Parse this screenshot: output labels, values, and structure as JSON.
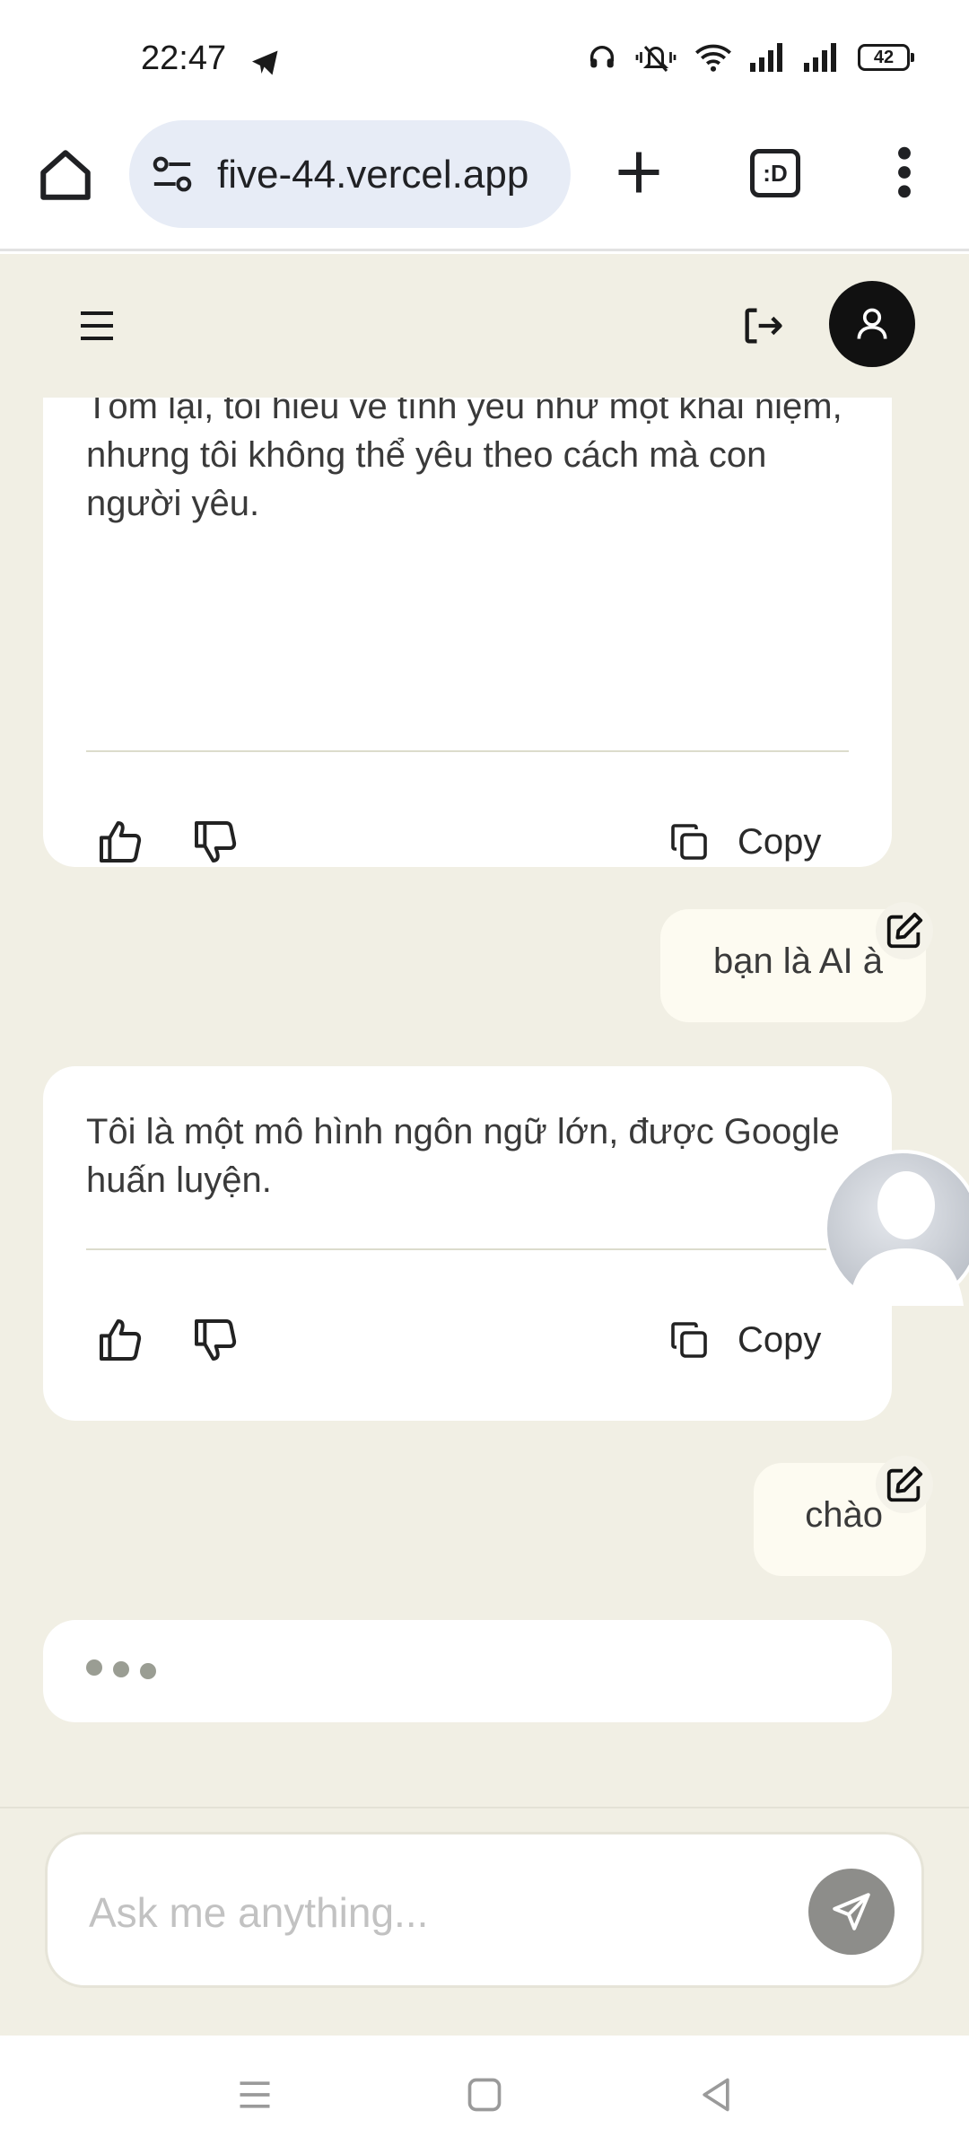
{
  "status_bar": {
    "time": "22:47",
    "battery": "42",
    "icons": [
      "telegram-icon",
      "headset-icon",
      "silent-vibrate-icon",
      "wifi-icon",
      "signal-icon",
      "signal-icon",
      "battery-icon"
    ]
  },
  "browser": {
    "url": "five-44.vercel.app",
    "tabs_label": ":D",
    "icons": [
      "home-icon",
      "site-settings-icon",
      "plus-icon",
      "tab-switcher-icon",
      "more-vert-icon"
    ]
  },
  "app_header": {
    "icons": [
      "hamburger-icon",
      "logout-icon",
      "user-icon"
    ]
  },
  "conversation": {
    "messages": [
      {
        "role": "assistant",
        "text": "trên kiến thức mà tôi có được.\n\nTóm lại, tôi hiểu về tình yêu như một khái niệm, nhưng tôi không thể yêu theo cách mà con người yêu."
      },
      {
        "role": "user",
        "text": "bạn là AI à"
      },
      {
        "role": "assistant",
        "text": "Tôi là một mô hình ngôn ngữ lớn, được Google huấn luyện."
      },
      {
        "role": "user",
        "text": "chào"
      }
    ],
    "copy_label": "Copy",
    "typing": true
  },
  "input": {
    "placeholder": "Ask me anything..."
  },
  "colors": {
    "app_background": "#f1efe4",
    "card_background": "#ffffff",
    "user_bubble": "#fdfbf1",
    "send_button": "#8d8d8a"
  }
}
